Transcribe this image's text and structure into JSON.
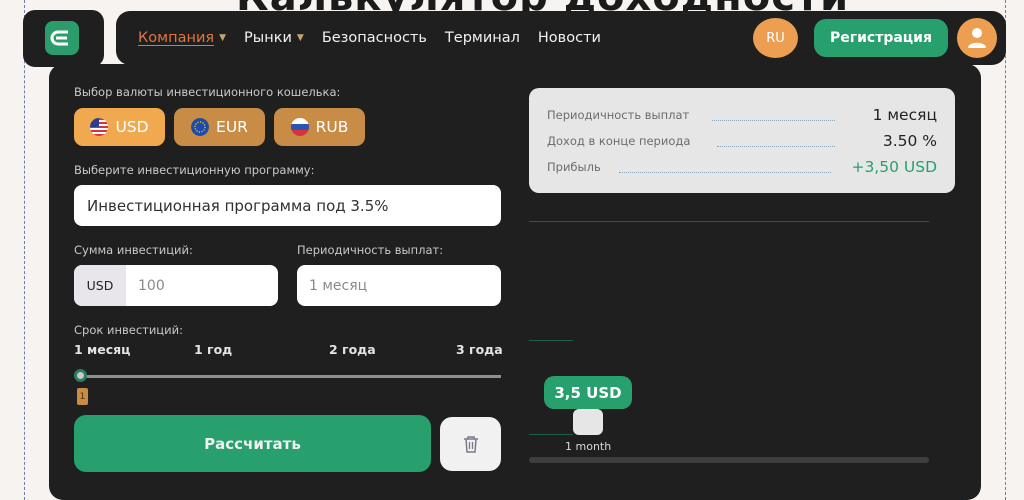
{
  "page": {
    "title_text": "Калькулятор доходности"
  },
  "header": {
    "nav": [
      {
        "label": "Компания",
        "active": true
      },
      {
        "label": "Рынки",
        "active": false
      },
      {
        "label": "Безопасность"
      },
      {
        "label": "Терминал"
      },
      {
        "label": "Новости"
      }
    ],
    "lang": "RU",
    "register_label": "Регистрация"
  },
  "calculator": {
    "currency_label": "Выбор валюты инвестиционного кошелька:",
    "currencies": [
      {
        "code": "USD",
        "flag": "us-flag-icon",
        "active": true
      },
      {
        "code": "EUR",
        "flag": "eu-flag-icon",
        "active": false
      },
      {
        "code": "RUB",
        "flag": "ru-flag-icon",
        "active": false
      }
    ],
    "program_label": "Выберите инвестиционную программу:",
    "program_value": "Инвестиционная программа под 3.5%",
    "amount_label": "Сумма инвестиций:",
    "amount_prefix": "USD",
    "amount_placeholder": "100",
    "period_label": "Периодичность выплат:",
    "period_placeholder": "1 месяц",
    "term_label": "Срок инвестиций:",
    "term_ticks": [
      "1 месяц",
      "1 год",
      "2 года",
      "3 года"
    ],
    "slider_value": "1",
    "calculate_label": "Рассчитать"
  },
  "summary": {
    "rows": [
      {
        "label": "Периодичность выплат",
        "value": "1 месяц"
      },
      {
        "label": "Доход в конце периода",
        "value": "3.50 %"
      },
      {
        "label": "Прибыль",
        "value": "+3,50 USD"
      }
    ]
  },
  "chart": {
    "bubble_value": "3,5 USD",
    "x_label": "1 month"
  },
  "colors": {
    "accent_green": "#27a06e",
    "accent_orange": "#f0a94f",
    "panel_dark": "#1f1f1f"
  }
}
